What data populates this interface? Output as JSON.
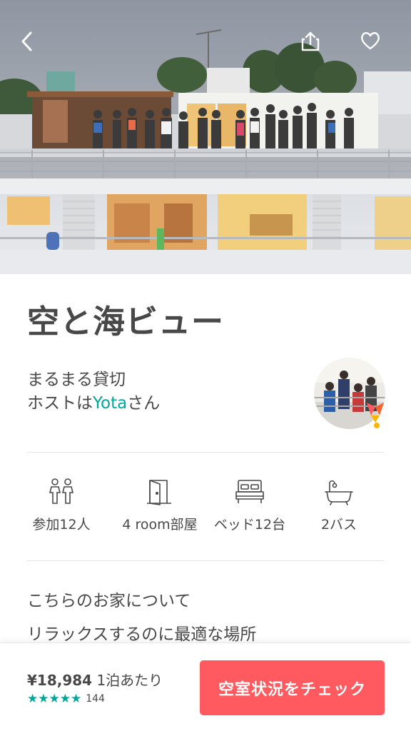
{
  "listing": {
    "title": "空と海ビュー",
    "type_line": "まるまる貸切",
    "host_prefix": "ホストは",
    "host_name": "Yota",
    "host_suffix": "さん"
  },
  "amenities": [
    {
      "icon": "guests-icon",
      "label": "参加12人"
    },
    {
      "icon": "door-icon",
      "label": "4 room部屋"
    },
    {
      "icon": "bed-icon",
      "label": "ベッド12台"
    },
    {
      "icon": "bathtub-icon",
      "label": "2バス"
    }
  ],
  "about": {
    "heading": "こちらのお家について",
    "tagline": "リラックスするのに最適な場所"
  },
  "booking": {
    "price": "¥18,984",
    "price_unit": " 1泊あたり",
    "stars": "★★★★★",
    "review_count": "144",
    "cta": "空室状況をチェック"
  },
  "colors": {
    "accent": "#ff5a5f",
    "teal": "#00a699",
    "text": "#484848"
  }
}
